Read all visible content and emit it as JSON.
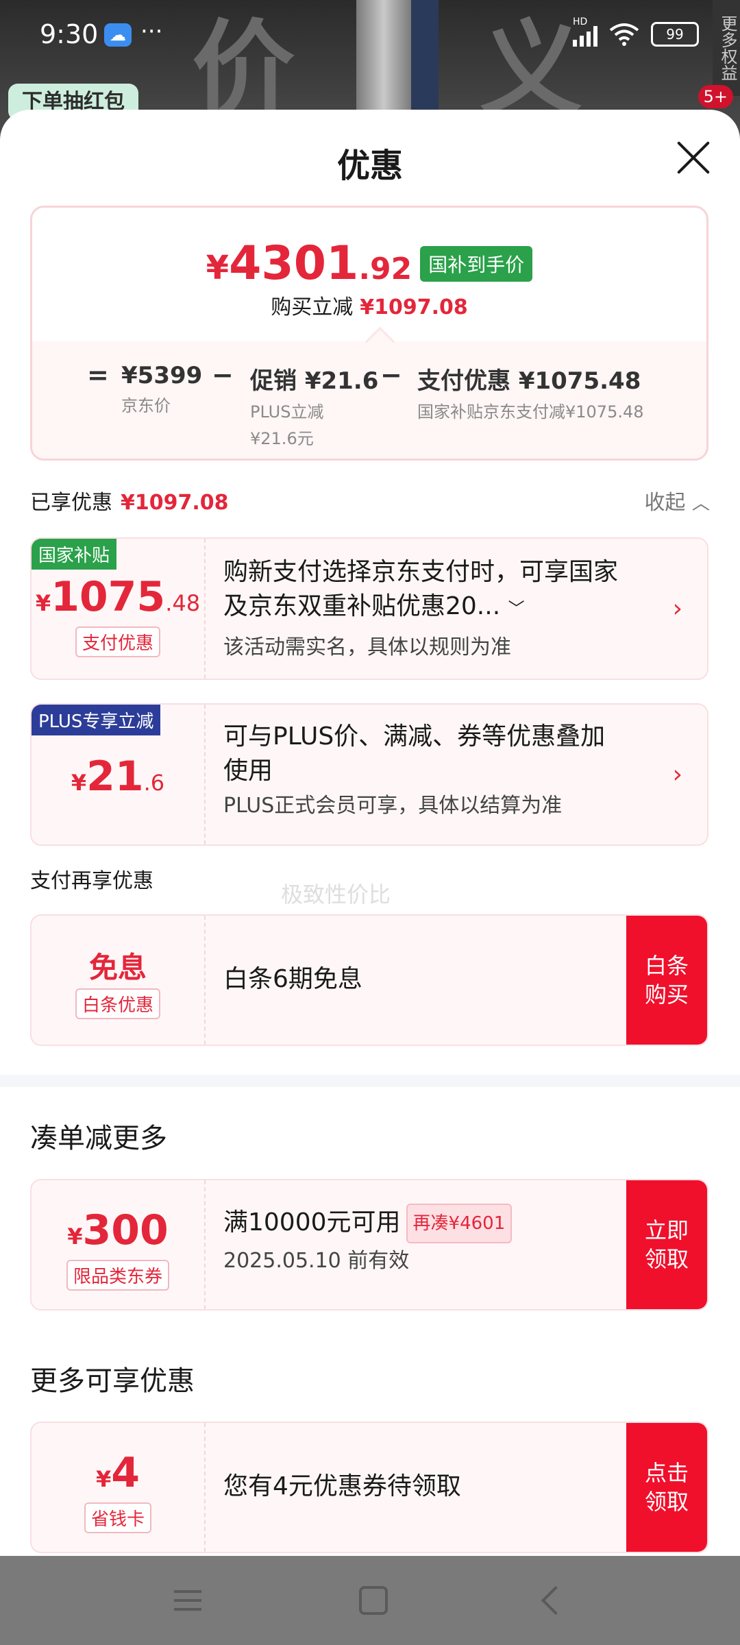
{
  "status": {
    "time": "9:30",
    "battery": "99",
    "hd": "HD"
  },
  "background": {
    "red_pack": "下单抽红包",
    "side_label": "更多权益",
    "side_count": "5+"
  },
  "sheet": {
    "title": "优惠"
  },
  "summary": {
    "price_yen": "¥",
    "price_int": "4301",
    "price_dec": ".92",
    "price_tag": "国补到手价",
    "reduce_label": "购买立减",
    "reduce_amount": "¥1097.08",
    "eq": "=",
    "minus": "−",
    "jd_price": "¥5399",
    "jd_price_label": "京东价",
    "promo": "促销 ¥21.6",
    "promo_sub1": "PLUS立减",
    "promo_sub2": "¥21.6元",
    "pay": "支付优惠 ¥1075.48",
    "pay_sub": "国家补贴京东支付减¥1075.48"
  },
  "enjoyed": {
    "label": "已享优惠",
    "amount": "¥1097.08",
    "collapse": "收起"
  },
  "coupons": {
    "gov": {
      "tag": "国家补贴",
      "yen": "¥",
      "int": "1075",
      "dec": ".48",
      "type": "支付优惠",
      "title_line1": "购新支付选择京东支付时，可享国家",
      "title_line2": "及京东双重补贴优惠20...",
      "sub": "该活动需实名，具体以规则为准"
    },
    "plus": {
      "tag": "PLUS专享立减",
      "yen": "¥",
      "int": "21",
      "dec": ".6",
      "title_line1": "可与PLUS价、满减、券等优惠叠加",
      "title_line2": "使用",
      "sub": "PLUS正式会员可享，具体以结算为准"
    },
    "pay_again_label": "支付再享优惠",
    "baitiao": {
      "big": "免息",
      "type": "白条优惠",
      "title": "白条6期免息",
      "btn_line1": "白条",
      "btn_line2": "购买"
    }
  },
  "more_reduce": {
    "heading": "凑单减更多",
    "coupon": {
      "yen": "¥",
      "int": "300",
      "type": "限品类东券",
      "title": "满10000元可用",
      "again": "再凑¥4601",
      "expire": "2025.05.10 前有效",
      "btn_line1": "立即",
      "btn_line2": "领取"
    }
  },
  "more_offers": {
    "heading": "更多可享优惠",
    "coupon": {
      "yen": "¥",
      "int": "4",
      "type": "省钱卡",
      "title": "您有4元优惠券待领取",
      "btn_line1": "点击",
      "btn_line2": "领取"
    }
  },
  "watermark": "极致性价比",
  "colors": {
    "accent": "#e4263a",
    "button_red": "#f0102c",
    "gov_green": "#2aa14a",
    "plus_blue": "#2c3d99"
  }
}
